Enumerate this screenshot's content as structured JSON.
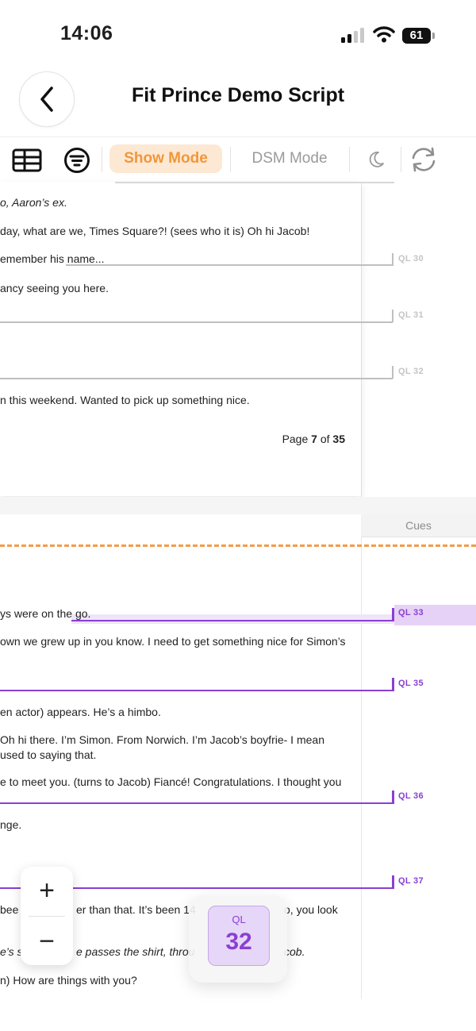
{
  "status_bar": {
    "time": "14:06",
    "battery": "61"
  },
  "header": {
    "title": "Fit Prince Demo Script"
  },
  "toolbar": {
    "show_mode_label": "Show Mode",
    "dsm_mode_label": "DSM Mode"
  },
  "page_top": {
    "lines": [
      "o, Aaron’s ex.",
      "day, what are we, Times Square?! (sees who it is) Oh hi Jacob!",
      "emember his name...",
      "ancy seeing you here.",
      "n this weekend. Wanted to pick up something nice."
    ],
    "page_label_prefix": "Page ",
    "page_current": "7",
    "page_of": " of ",
    "page_total": "35"
  },
  "cues_header": "Cues",
  "page_bottom": {
    "lines": [
      "ys were on the go.",
      "own we grew up in you know. I need to get something nice for Simon’s",
      "en actor) appears. He’s a himbo.",
      "Oh hi there. I’m Simon. From Norwich. I’m Jacob’s boyfrie- I mean",
      "used to saying that.",
      "e to meet you. (turns to Jacob) Fiancé! Congratulations. I thought you",
      "nge.",
      "bee",
      "er than that. It’s been 14",
      "o, you look",
      "e’s s",
      "e passes the shirt, throu",
      "cob.",
      "n) How are things with you?"
    ]
  },
  "cues": [
    {
      "label": "QL 30",
      "state": "past"
    },
    {
      "label": "QL 31",
      "state": "past"
    },
    {
      "label": "QL 32",
      "state": "past"
    },
    {
      "label": "QL 33",
      "state": "current"
    },
    {
      "label": "QL 35",
      "state": "upcoming"
    },
    {
      "label": "QL 36",
      "state": "upcoming"
    },
    {
      "label": "QL 37",
      "state": "upcoming"
    }
  ],
  "zoom": {
    "in": "+",
    "out": "−"
  },
  "ql_widget": {
    "label": "QL",
    "number": "32"
  },
  "colors": {
    "accent_orange": "#f0973a",
    "cue_purple": "#8a3fd1",
    "cue_gray": "#bfbfbf"
  }
}
